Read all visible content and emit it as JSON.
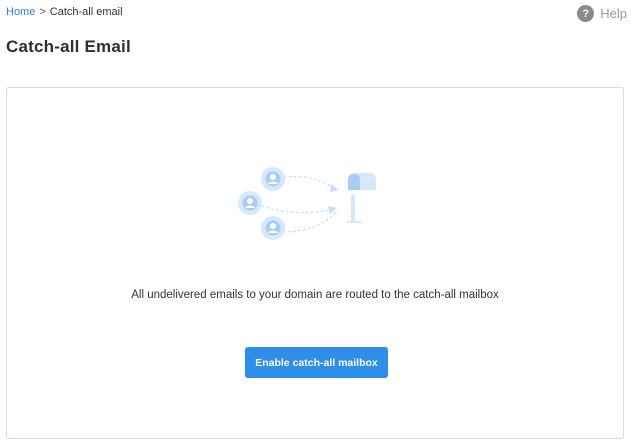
{
  "breadcrumb": {
    "home": "Home",
    "separator": ">",
    "current": "Catch-all email"
  },
  "help": {
    "icon": "?",
    "label": "Help"
  },
  "page": {
    "title": "Catch-all Email"
  },
  "card": {
    "description": "All undelivered emails to your domain are routed to the catch-all mailbox",
    "button_label": "Enable catch-all mailbox"
  },
  "colors": {
    "accent": "#2e8ee8",
    "link": "#2d7fd3",
    "illustration_light": "#d6e8fb",
    "illustration_mid": "#a9cdf4"
  }
}
